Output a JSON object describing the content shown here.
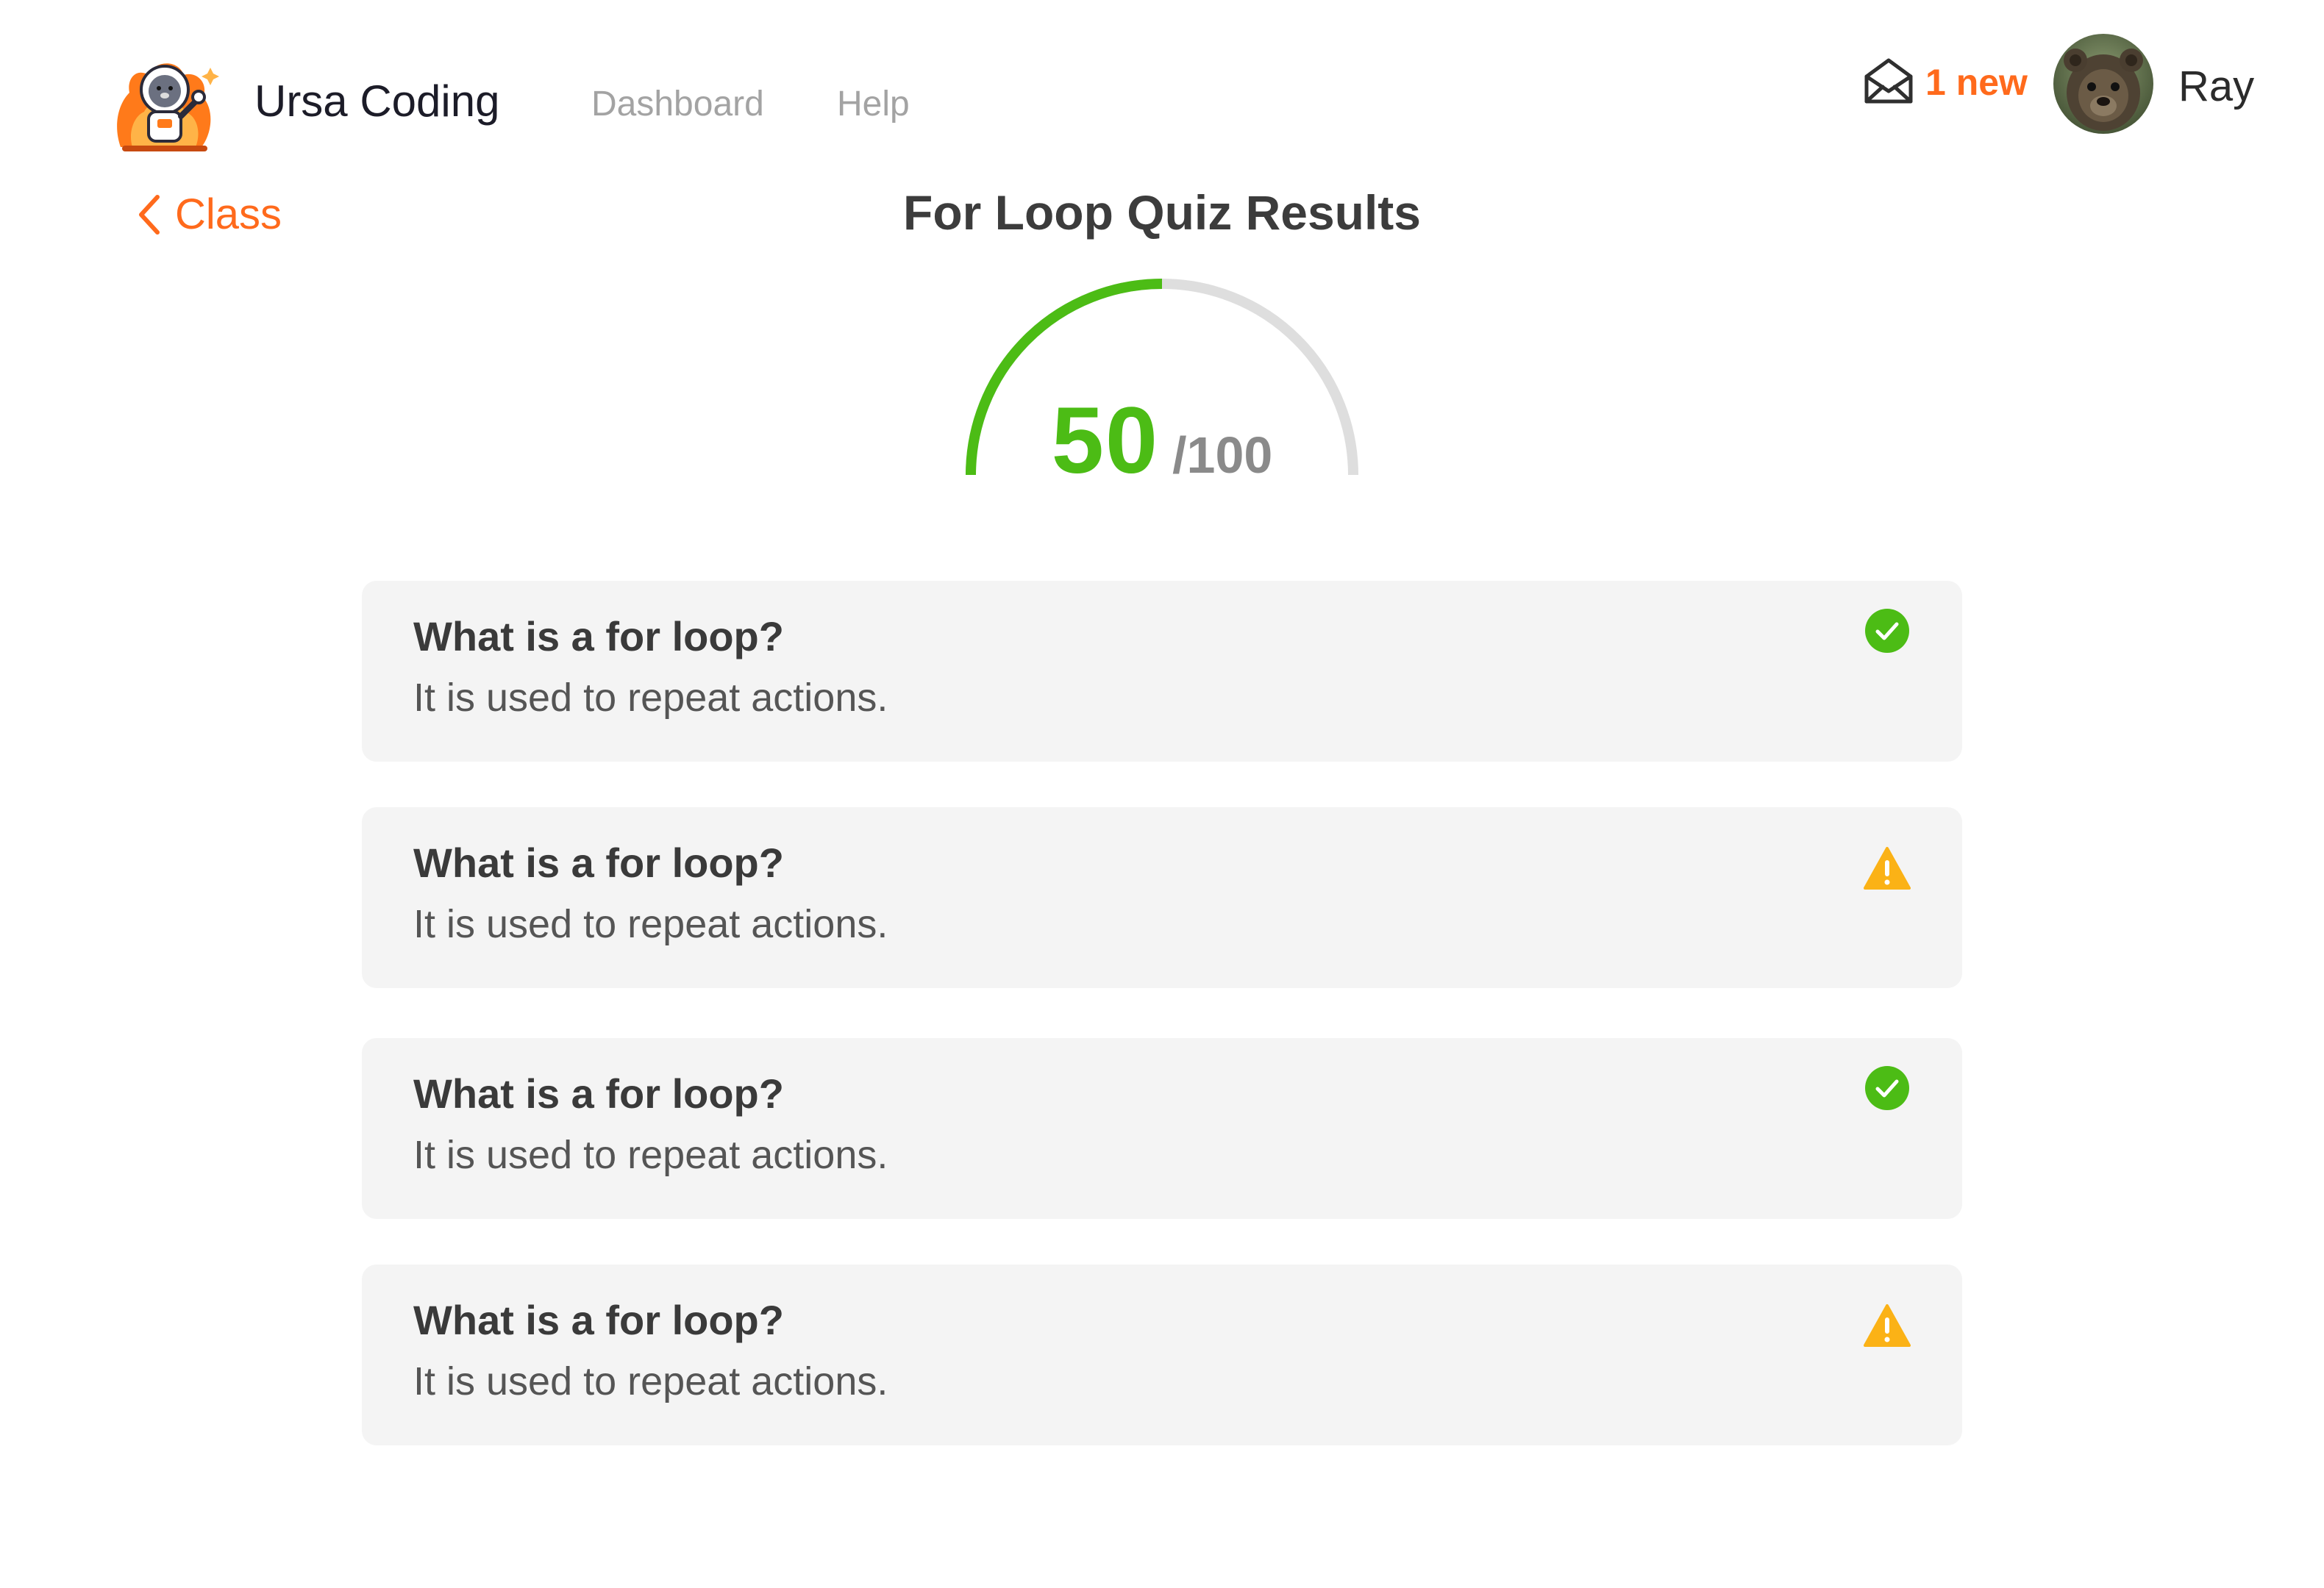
{
  "header": {
    "brand": "Ursa Coding",
    "nav": [
      {
        "label": "Dashboard"
      },
      {
        "label": "Help"
      }
    ],
    "notifications": {
      "label": "1 new",
      "icon": "mail-open-icon"
    },
    "user": {
      "name": "Ray",
      "avatar": "bear-avatar"
    }
  },
  "back_link": {
    "label": "Class",
    "icon": "chevron-left-icon"
  },
  "page_title": "For Loop Quiz Results",
  "score": {
    "value": "50",
    "total": "/100",
    "fraction": 0.5
  },
  "questions": [
    {
      "question": "What is a for loop?",
      "answer": "It is used to repeat actions.",
      "status": "correct",
      "icon": "check-circle-icon"
    },
    {
      "question": "What is a for loop?",
      "answer": "It is used to repeat actions.",
      "status": "warning",
      "icon": "warning-triangle-icon"
    },
    {
      "question": "What is a for loop?",
      "answer": "It is used to repeat actions.",
      "status": "correct",
      "icon": "check-circle-icon"
    },
    {
      "question": "What is a for loop?",
      "answer": "It is used to repeat actions.",
      "status": "warning",
      "icon": "warning-triangle-icon"
    }
  ],
  "colors": {
    "accent": "#ff6a1c",
    "success": "#4cbc15",
    "warning": "#fbb216",
    "card_bg": "#f4f4f4",
    "gauge_track": "#dedede"
  }
}
